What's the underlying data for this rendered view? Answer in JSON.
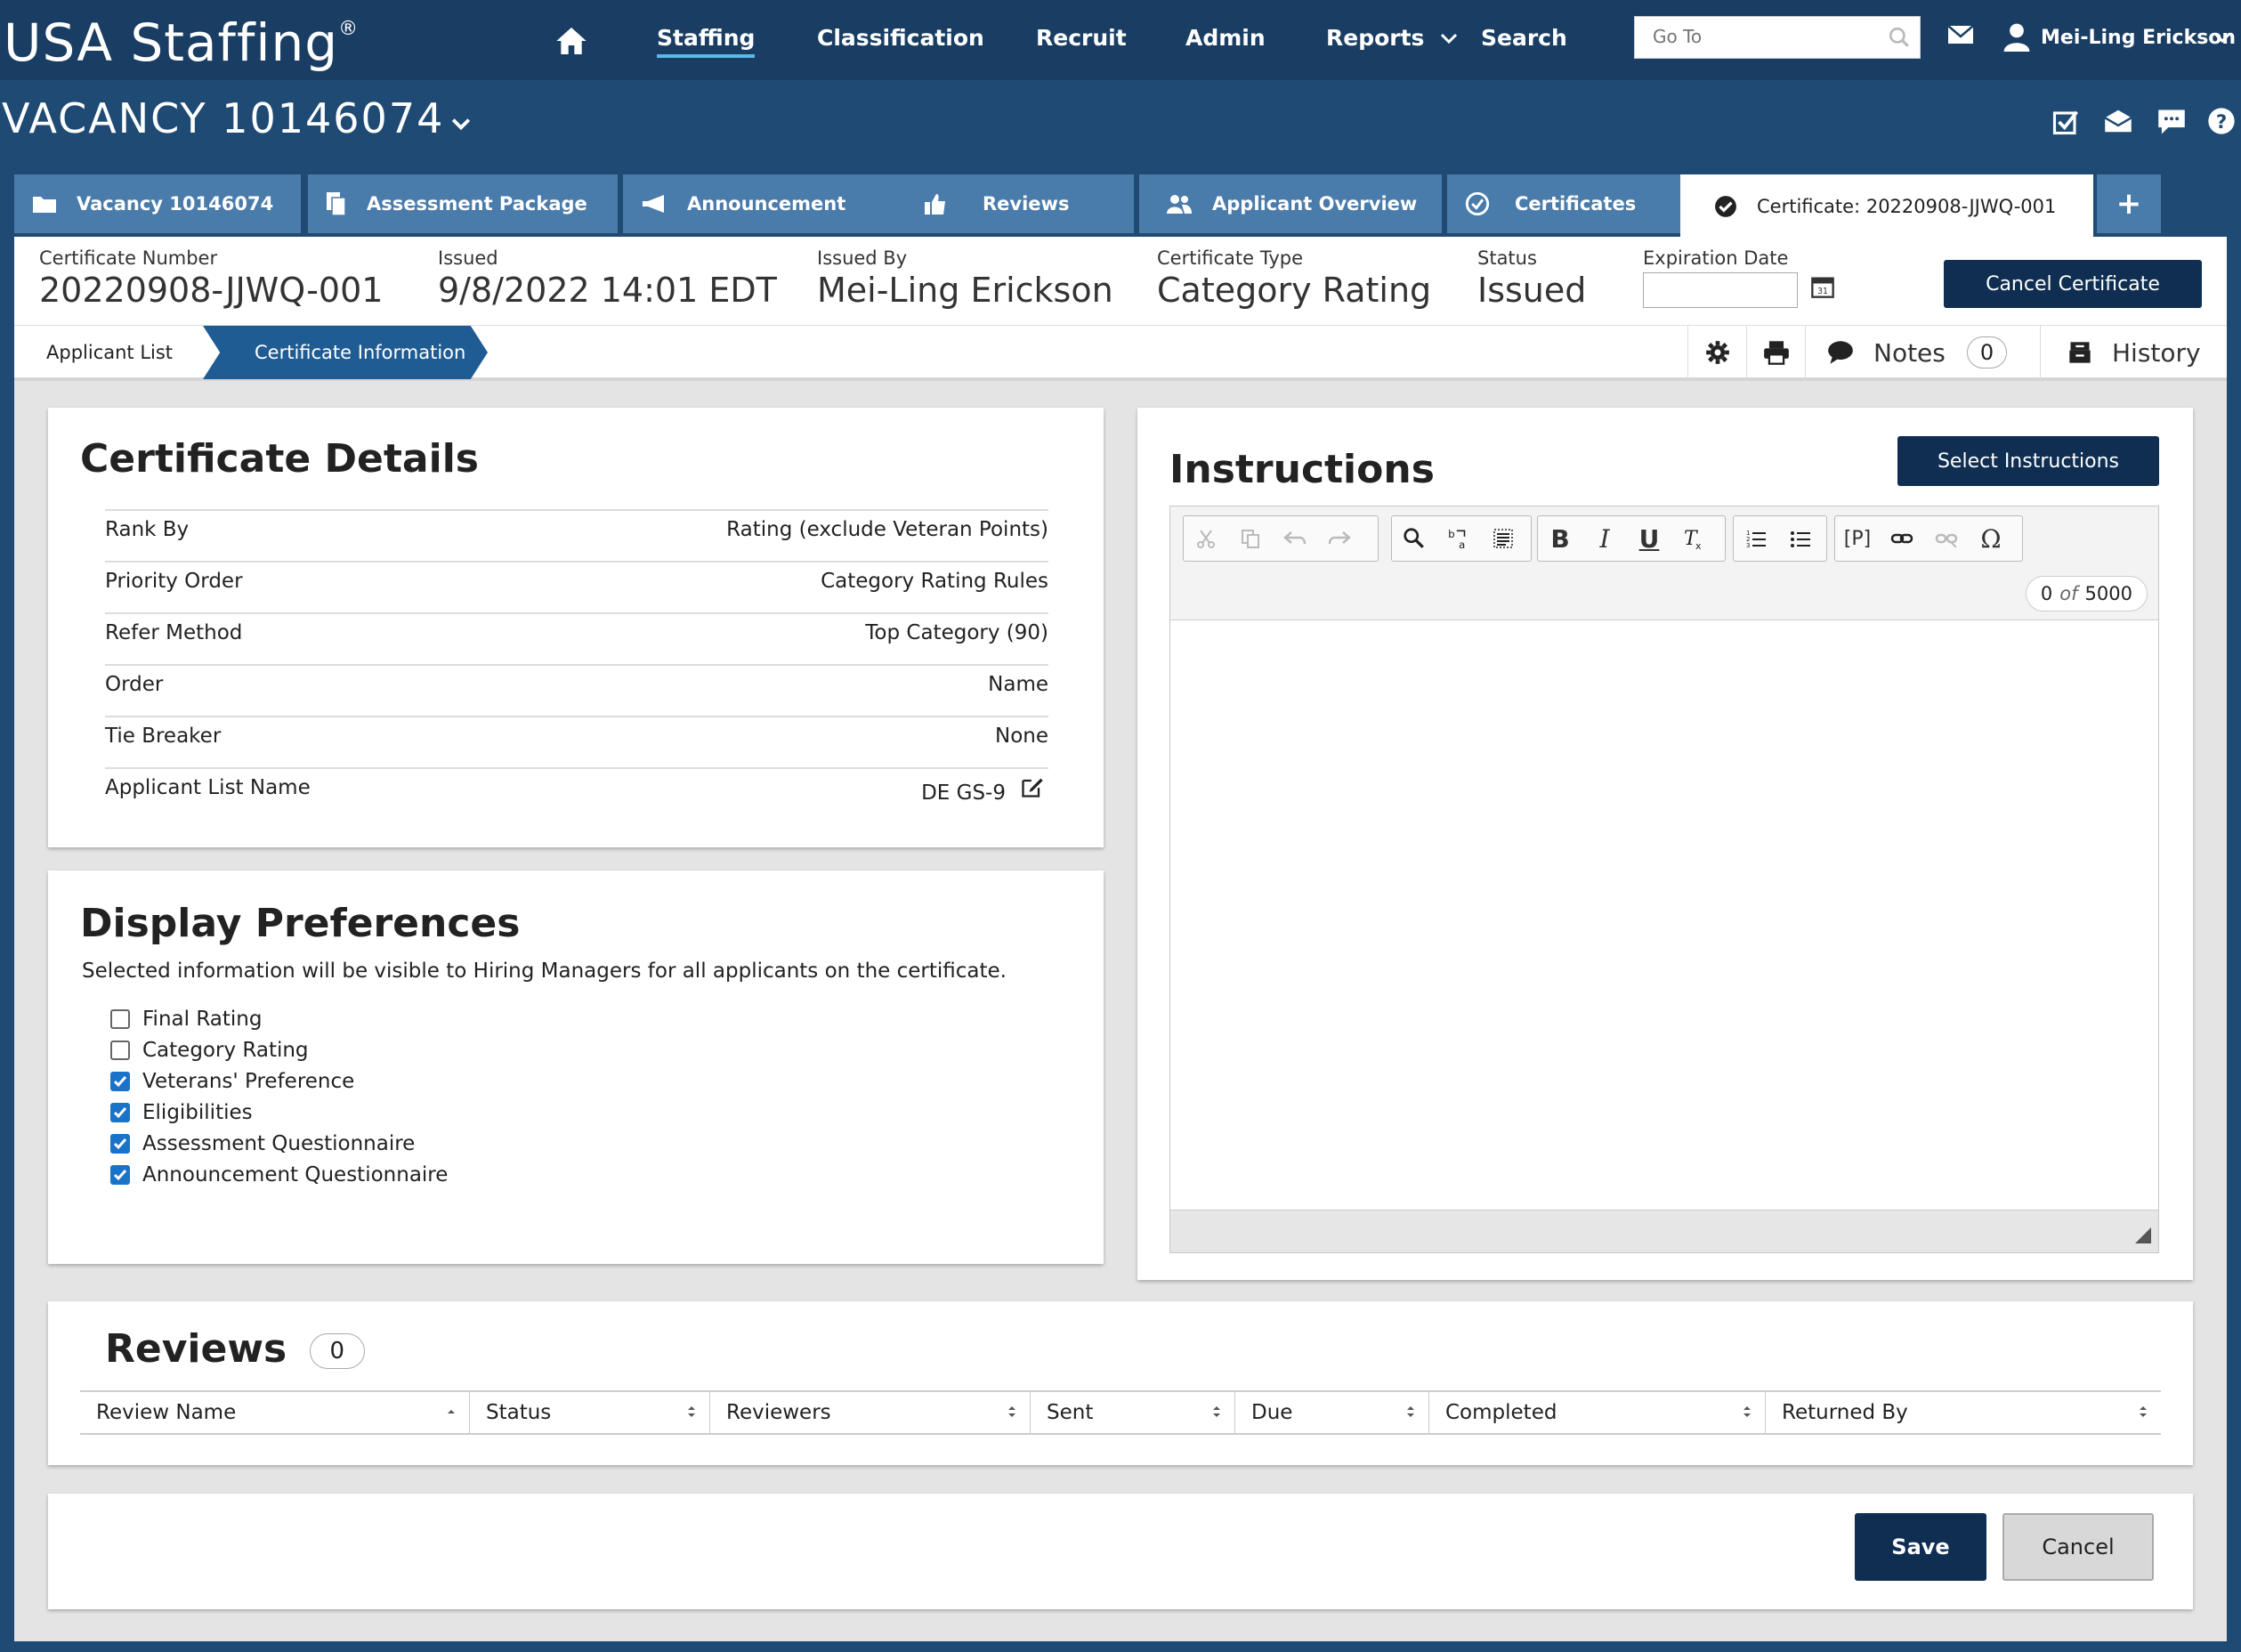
{
  "nav": {
    "logo": "USA Staffing",
    "logo_mark": "®",
    "items": [
      "Staffing",
      "Classification",
      "Recruit",
      "Admin",
      "Reports",
      "Search"
    ],
    "goto_placeholder": "Go To",
    "user": "Mei-Ling Erickson"
  },
  "vacancy": {
    "title": "VACANCY 10146074"
  },
  "tabs": [
    "Vacancy 10146074",
    "Assessment Package",
    "Announcement",
    "Reviews",
    "Applicant Overview",
    "Certificates",
    "Certificate: 20220908-JJWQ-001",
    "+"
  ],
  "certificate": {
    "number_label": "Certificate Number",
    "number": "20220908-JJWQ-001",
    "issued_label": "Issued",
    "issued": "9/8/2022 14:01 EDT",
    "issued_by_label": "Issued By",
    "issued_by": "Mei-Ling Erickson",
    "type_label": "Certificate Type",
    "type": "Category Rating",
    "status_label": "Status",
    "status": "Issued",
    "expiration_label": "Expiration Date",
    "cancel_button": "Cancel Certificate"
  },
  "subnav": {
    "applicant_list": "Applicant List",
    "certificate_information": "Certificate Information",
    "notes": "Notes",
    "notes_count": "0",
    "history": "History"
  },
  "details": {
    "title": "Certificate Details",
    "rows": [
      {
        "k": "Rank By",
        "v": "Rating (exclude Veteran Points)"
      },
      {
        "k": "Priority Order",
        "v": "Category Rating Rules"
      },
      {
        "k": "Refer Method",
        "v": "Top Category (90)"
      },
      {
        "k": "Order",
        "v": "Name"
      },
      {
        "k": "Tie Breaker",
        "v": "None"
      },
      {
        "k": "Applicant List Name",
        "v": "DE GS-9"
      }
    ]
  },
  "prefs": {
    "title": "Display Preferences",
    "desc": "Selected information will be visible to Hiring Managers for all applicants on the certificate.",
    "items": [
      {
        "label": "Final Rating",
        "checked": false
      },
      {
        "label": "Category Rating",
        "checked": false
      },
      {
        "label": "Veterans' Preference",
        "checked": true
      },
      {
        "label": "Eligibilities",
        "checked": true
      },
      {
        "label": "Assessment Questionnaire",
        "checked": true
      },
      {
        "label": "Announcement Questionnaire",
        "checked": true
      }
    ]
  },
  "instructions": {
    "title": "Instructions",
    "select_button": "Select Instructions",
    "count": "0",
    "of": "of",
    "max": "5000",
    "toolbar": {
      "bold": "B",
      "italic": "I",
      "underline": "U",
      "paragraph": "[P]",
      "omega": "Ω"
    }
  },
  "reviews": {
    "title": "Reviews",
    "count": "0",
    "columns": [
      "Review Name",
      "Status",
      "Reviewers",
      "Sent",
      "Due",
      "Completed",
      "Returned By"
    ]
  },
  "footer": {
    "save": "Save",
    "cancel": "Cancel"
  }
}
